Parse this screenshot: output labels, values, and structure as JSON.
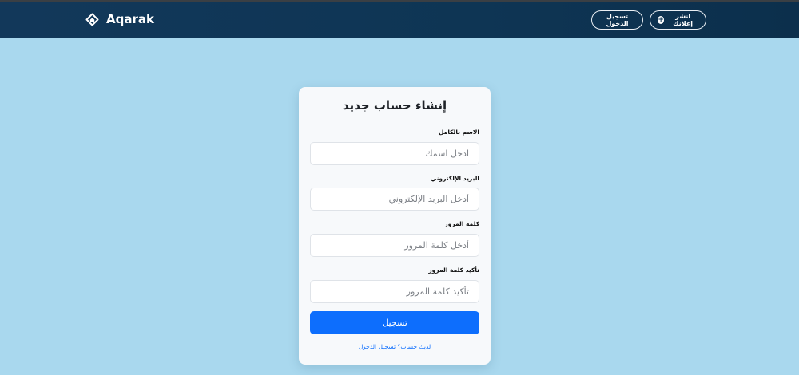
{
  "navbar": {
    "brand_name": "Aqarak",
    "brand_icon": "home-diamond-icon",
    "post_ad_label": "انشر إعلانك",
    "post_ad_icon": "plus-circle-icon",
    "login_label": "تسجيل الدخول"
  },
  "form": {
    "title": "إنشاء حساب جديد",
    "fields": [
      {
        "label": "الاسم بالكامل",
        "placeholder": "ادخل اسمك"
      },
      {
        "label": "البريد الإلكتروني",
        "placeholder": "أدخل البريد الإلكتروني"
      },
      {
        "label": "كلمة المرور",
        "placeholder": "أدخل كلمة المرور"
      },
      {
        "label": "تأكيد كلمة المرور",
        "placeholder": "تأكيد كلمة المرور"
      }
    ],
    "submit_label": "تسجيل",
    "login_link": "لديك حساب؟ تسجيل الدخول"
  },
  "colors": {
    "background": "#a9d8ee",
    "navbar": "#0e3554",
    "primary": "#0d6efd"
  }
}
